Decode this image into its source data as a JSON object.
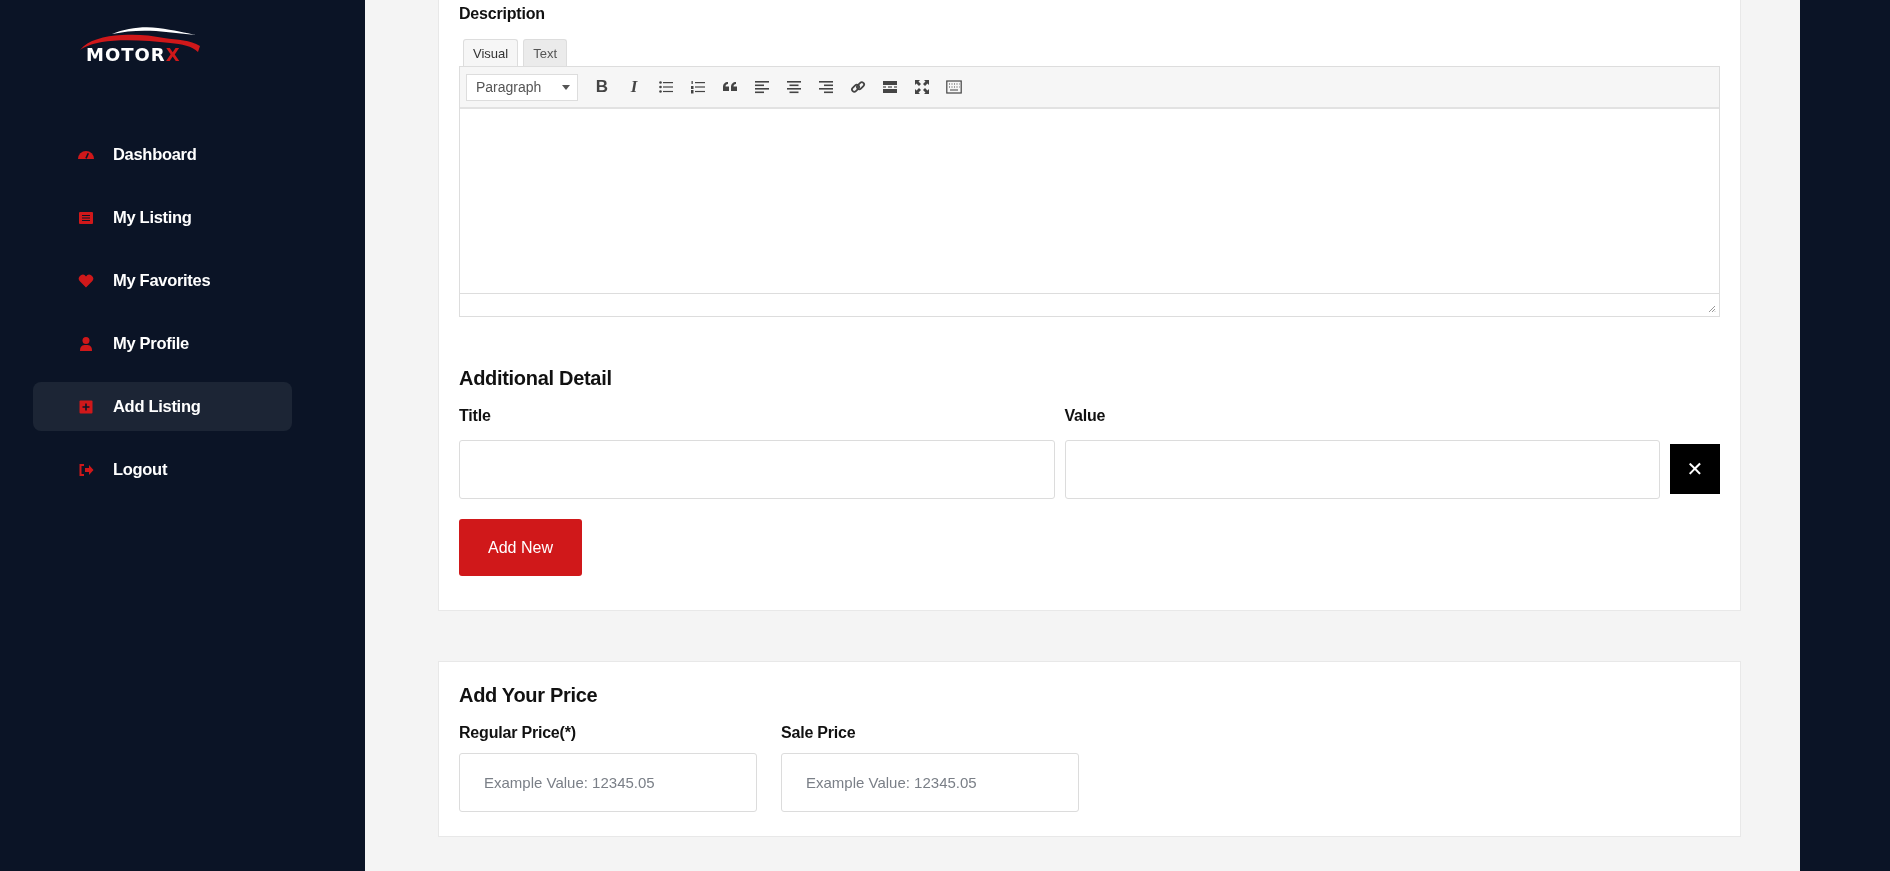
{
  "sidebar": {
    "logo": {
      "text": "MOTOR",
      "accent": "X"
    },
    "items": [
      {
        "label": "Dashboard",
        "selected": false
      },
      {
        "label": "My Listing",
        "selected": false
      },
      {
        "label": "My Favorites",
        "selected": false
      },
      {
        "label": "My Profile",
        "selected": false
      },
      {
        "label": "Add Listing",
        "selected": true
      },
      {
        "label": "Logout",
        "selected": false
      }
    ]
  },
  "description": {
    "label": "Description",
    "editor": {
      "tabs": [
        {
          "label": "Visual",
          "selected": true
        },
        {
          "label": "Text",
          "selected": false
        }
      ],
      "format_select": "Paragraph",
      "bold_label": "B",
      "italic_label": "I"
    }
  },
  "additional_detail": {
    "heading": "Additional Detail",
    "fields": [
      {
        "label": "Title"
      },
      {
        "label": "Value"
      }
    ],
    "remove_button": "✕",
    "add_button": "Add New"
  },
  "price": {
    "heading": "Add Your Price",
    "fields": [
      {
        "label": "Regular Price(*)",
        "placeholder": "Example Value: 12345.05"
      },
      {
        "label": "Sale Price",
        "placeholder": "Example Value: 12345.05"
      }
    ]
  }
}
